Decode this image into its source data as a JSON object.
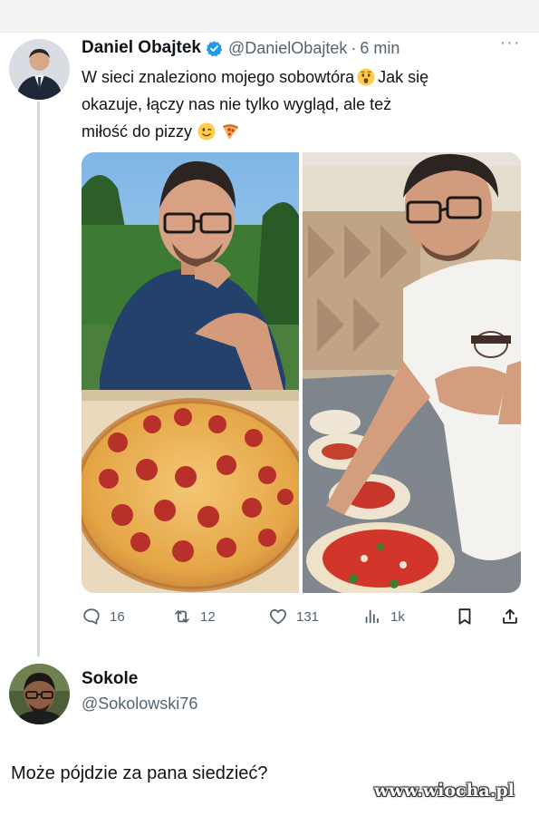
{
  "tweet": {
    "author_name": "Daniel Obajtek",
    "author_handle": "@DanielObajtek",
    "separator": "·",
    "time": "6 min",
    "more_label": "···",
    "text_lines": [
      "W sieci znaleziono mojego sobowtóra",
      "Jak się",
      "okazuje, łączy nas nie tylko wygląd, ale też",
      "miłość do pizzy"
    ],
    "emojis": [
      "astonished-face",
      "winking-face",
      "pizza-slice"
    ],
    "stats": {
      "replies": "16",
      "retweets": "12",
      "likes": "131",
      "views": "1k"
    }
  },
  "reply": {
    "author_name": "Sokole",
    "author_handle": "@Sokolowski76",
    "text": "Może pójdzie za pana siedzieć?"
  },
  "watermark": "www.wiocha.pl",
  "colors": {
    "text_primary": "#0f1419",
    "text_secondary": "#536471",
    "verified_blue": "#1d9bf0",
    "thread_line": "#cfd9de"
  },
  "icons": {
    "reply": "speech-bubble-icon",
    "retweet": "retweet-arrows-icon",
    "like": "heart-icon",
    "views": "bar-chart-icon",
    "bookmark": "bookmark-icon",
    "share": "share-upload-icon"
  }
}
